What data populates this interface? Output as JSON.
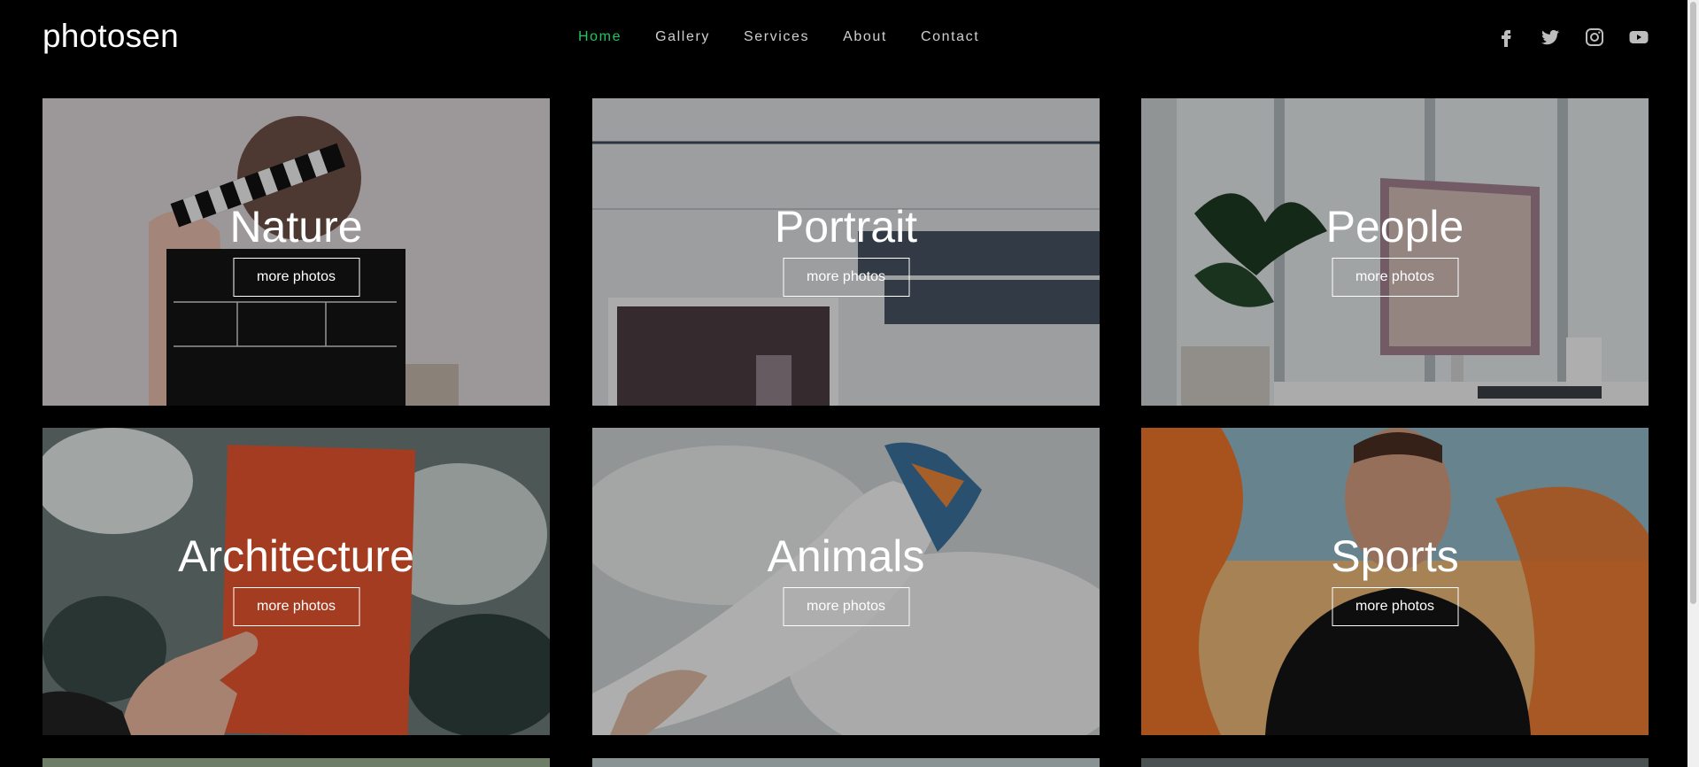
{
  "brand": {
    "logo": "photosen"
  },
  "nav": {
    "items": [
      {
        "label": "Home",
        "active": true
      },
      {
        "label": "Gallery"
      },
      {
        "label": "Services"
      },
      {
        "label": "About"
      },
      {
        "label": "Contact"
      }
    ]
  },
  "social": [
    "facebook-icon",
    "twitter-icon",
    "instagram-icon",
    "youtube-icon"
  ],
  "colors": {
    "accent": "#22c55e",
    "background": "#000000",
    "text": "#ffffff"
  },
  "tiles": [
    {
      "title": "Nature",
      "button": "more photos"
    },
    {
      "title": "Portrait",
      "button": "more photos"
    },
    {
      "title": "People",
      "button": "more photos"
    },
    {
      "title": "Architecture",
      "button": "more photos"
    },
    {
      "title": "Animals",
      "button": "more photos"
    },
    {
      "title": "Sports",
      "button": "more photos"
    }
  ]
}
